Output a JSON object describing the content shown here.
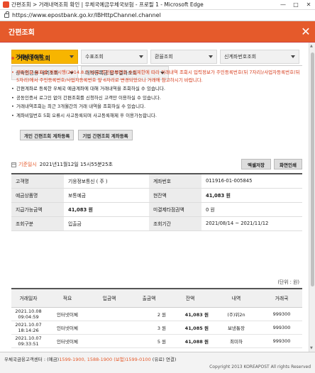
{
  "window": {
    "title": "간편조회 > 거래내역조회 확인 | 우체국예금우체국보험 - 프로필 1 - Microsoft Edge",
    "url": "https://www.epostbank.go.kr/IBHttpChannel.channel"
  },
  "header": {
    "title": "간편조회"
  },
  "menu": [
    {
      "label": "거래내역조회",
      "selected": true
    },
    {
      "label": "수표조회",
      "selected": false
    },
    {
      "label": "환율조회",
      "selected": false
    },
    {
      "label": "신계좌번호조회",
      "selected": false
    },
    {
      "label": "상속인금융 내역조회",
      "selected": false
    },
    {
      "label": "대학등록금 납부결과조회",
      "selected": false
    }
  ],
  "section": {
    "title": "거래내역조회",
    "notes": [
      {
        "text": "개인정보 보호법 개정시행(2014.8.7.)으로 주민등록번호 수집제한에 따라 거래내역 조회시 입력정보가 주민등록번호(뒤 7자리)/사업자등록번호(뒤 5자리)에서 주민등록번호/사업자등록번호 앞 6자리로 변경되었으니 거래에 참고하시기 바랍니다.",
        "red": true
      },
      {
        "text": "간편계좌로 등록한 우체국 예금계좌에 대해 거래내역을 조회하실 수 있습니다.",
        "red": false
      },
      {
        "text": "공동인증서 로그인 없이 간편조회를 신청하신 고객만 이용하실 수 있습니다.",
        "red": false
      },
      {
        "text": "거래내역조회는 최근 3개월간의 거래 내역을 조회하실 수 있습니다.",
        "red": false
      },
      {
        "text": "계좌비밀번호 5회 오류시 사고등록되며 사고등록해제 후 이용가능합니다.",
        "red": false
      }
    ],
    "buttons": {
      "individual": "개인 간편조회 계좌등록",
      "corporate": "기업 간편조회 계좌등록"
    }
  },
  "timestamp": {
    "label": "기준일시",
    "value": "2021년11월12일 15시55분25초"
  },
  "actions": {
    "excel": "엑셀저장",
    "print": "화면인쇄"
  },
  "info": [
    {
      "k1": "고객명",
      "v1": "기웅정보통신 ( 주 )",
      "k2": "계좌번호",
      "v2": "011916-01-005845"
    },
    {
      "k1": "예금상품명",
      "v1": "보통예금",
      "k2": "현잔액",
      "v2": "41,083 원"
    },
    {
      "k1": "지급가능금액",
      "v1": "41,083 원",
      "k2": "미결제타점권액",
      "v2": "0 원"
    },
    {
      "k1": "조회구분",
      "v1": "입출금",
      "k2": "조회기간",
      "v2": "2021/08/14 ~ 2021/11/12"
    }
  ],
  "unit_label": "(단위 : 원)",
  "transactions": {
    "headers": [
      "거래일자",
      "적요",
      "입금액",
      "출금액",
      "잔액",
      "내역",
      "거래국"
    ],
    "rows": [
      {
        "date": "2021.10.08",
        "time": "09:04:59",
        "memo": "인터넷이체",
        "deposit": "",
        "withdraw": "2 원",
        "balance": "41,083 원",
        "detail": "(주)위2n",
        "branch": "999300"
      },
      {
        "date": "2021.10.07",
        "time": "18:14:26",
        "memo": "인터넷이체",
        "deposit": "",
        "withdraw": "3 원",
        "balance": "41,085 원",
        "detail": "보낸통장",
        "branch": "999300"
      },
      {
        "date": "2021.10.07",
        "time": "09:33:51",
        "memo": "인터넷이체",
        "deposit": "",
        "withdraw": "5 원",
        "balance": "41,088 원",
        "detail": "최미하",
        "branch": "999300"
      }
    ]
  },
  "footer": {
    "prefix": "우체국금융고객센터 : (예금)",
    "phones": "1599-1900, 1588-1900 (보험)1599-0100",
    "suffix": " (유료) 연결)",
    "copyright": "Copyright 2013 KOREAPOST All rights Reserved"
  }
}
